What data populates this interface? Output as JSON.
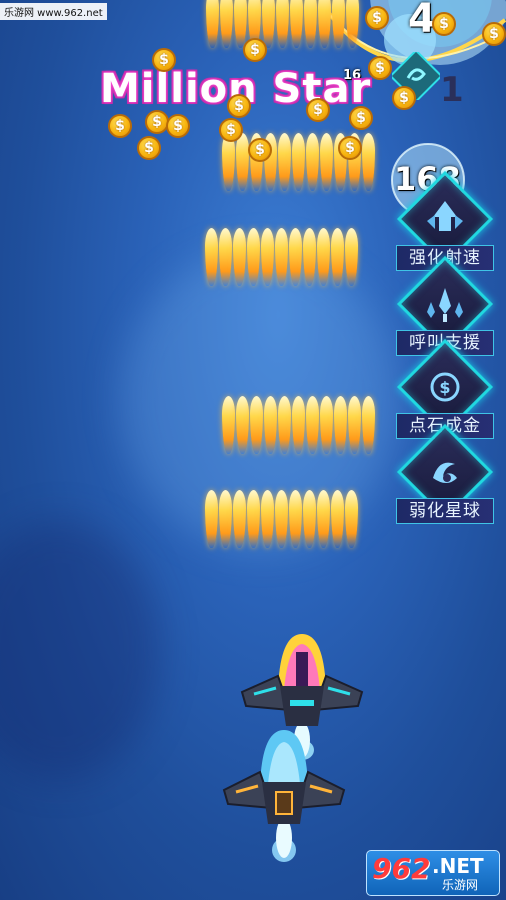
{
  "watermark": "乐游网 www.962.net",
  "title_banner": "Million Star",
  "score_counters": {
    "top_right": "4",
    "small_center": "16",
    "planet_hp": "168",
    "bar_digit": "1"
  },
  "skills": [
    {
      "label": "强化射速",
      "icon": "fire-rate-icon"
    },
    {
      "label": "呼叫支援",
      "icon": "call-support-icon"
    },
    {
      "label": "点石成金",
      "icon": "coin-icon"
    },
    {
      "label": "弱化星球",
      "icon": "weaken-planet-icon"
    }
  ],
  "coin_symbol": "$",
  "logo": {
    "number": "962",
    "net": ".NET",
    "sub": "乐游网"
  },
  "colors": {
    "background": "#2a62b8",
    "bullet": "#ffb22a",
    "coin": "#f8b50f",
    "skill_border": "#20d8e0",
    "title_glow": "#ff4fd8"
  }
}
